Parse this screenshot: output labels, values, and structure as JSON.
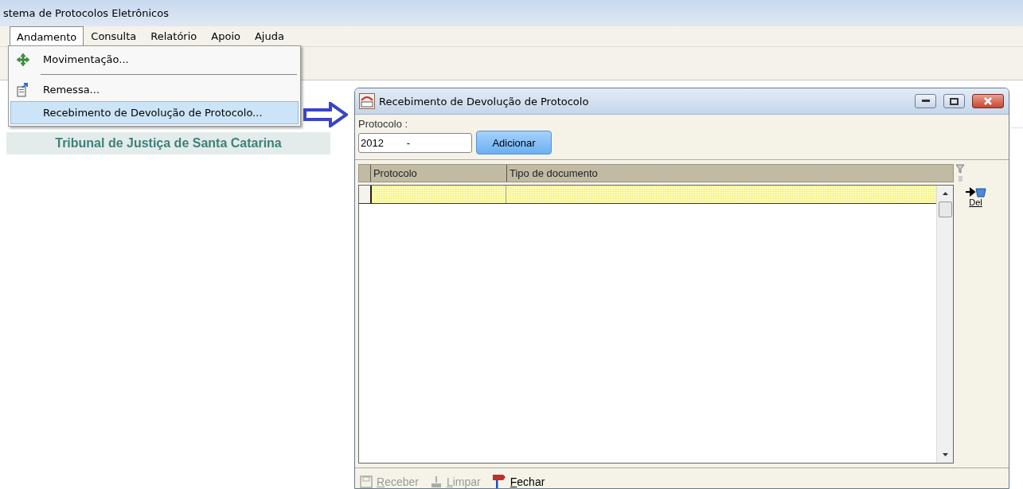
{
  "window": {
    "title": "stema de Protocolos Eletrônicos"
  },
  "menu_bar": [
    {
      "label": "Andamento",
      "selected": true
    },
    {
      "label": "Consulta",
      "selected": false
    },
    {
      "label": "Relatório",
      "selected": false
    },
    {
      "label": "Apoio",
      "selected": false
    },
    {
      "label": "Ajuda",
      "selected": false
    }
  ],
  "dropdown": [
    {
      "kind": "move",
      "label": "Movimentação...",
      "selected": false
    },
    {
      "kind": "separator"
    },
    {
      "kind": "send",
      "label": "Remessa...",
      "selected": false
    },
    {
      "kind": "plain",
      "label": "Recebimento de Devolução de Protocolo...",
      "selected": true
    }
  ],
  "banner": "Tribunal de Justiça de Santa Catarina",
  "dialog": {
    "title": "Recebimento de Devolução de Protocolo",
    "field_label": "Protocolo :",
    "field_value": "2012        -",
    "add_button": "Adicionar",
    "columns": [
      "Protocolo",
      "Tipo de documento"
    ],
    "del_button": "Del",
    "footer_buttons": [
      {
        "kind": "save",
        "label": "Receber",
        "disabled": true
      },
      {
        "kind": "brush",
        "label": "Limpar",
        "disabled": true
      },
      {
        "kind": "flag",
        "label": "Fechar",
        "disabled": false
      }
    ]
  }
}
